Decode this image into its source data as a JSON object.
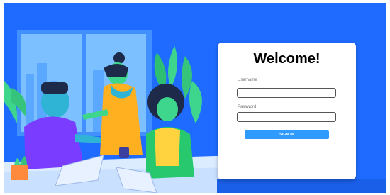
{
  "login": {
    "title": "Welcome!",
    "username_label": "Username",
    "username_value": "",
    "password_label": "Password",
    "password_value": "",
    "signin_label": "SIGN IN"
  },
  "colors": {
    "background": "#1f6bff",
    "card": "#ffffff",
    "button": "#2f9bff"
  },
  "illustration": {
    "name": "team-working-illustration"
  }
}
